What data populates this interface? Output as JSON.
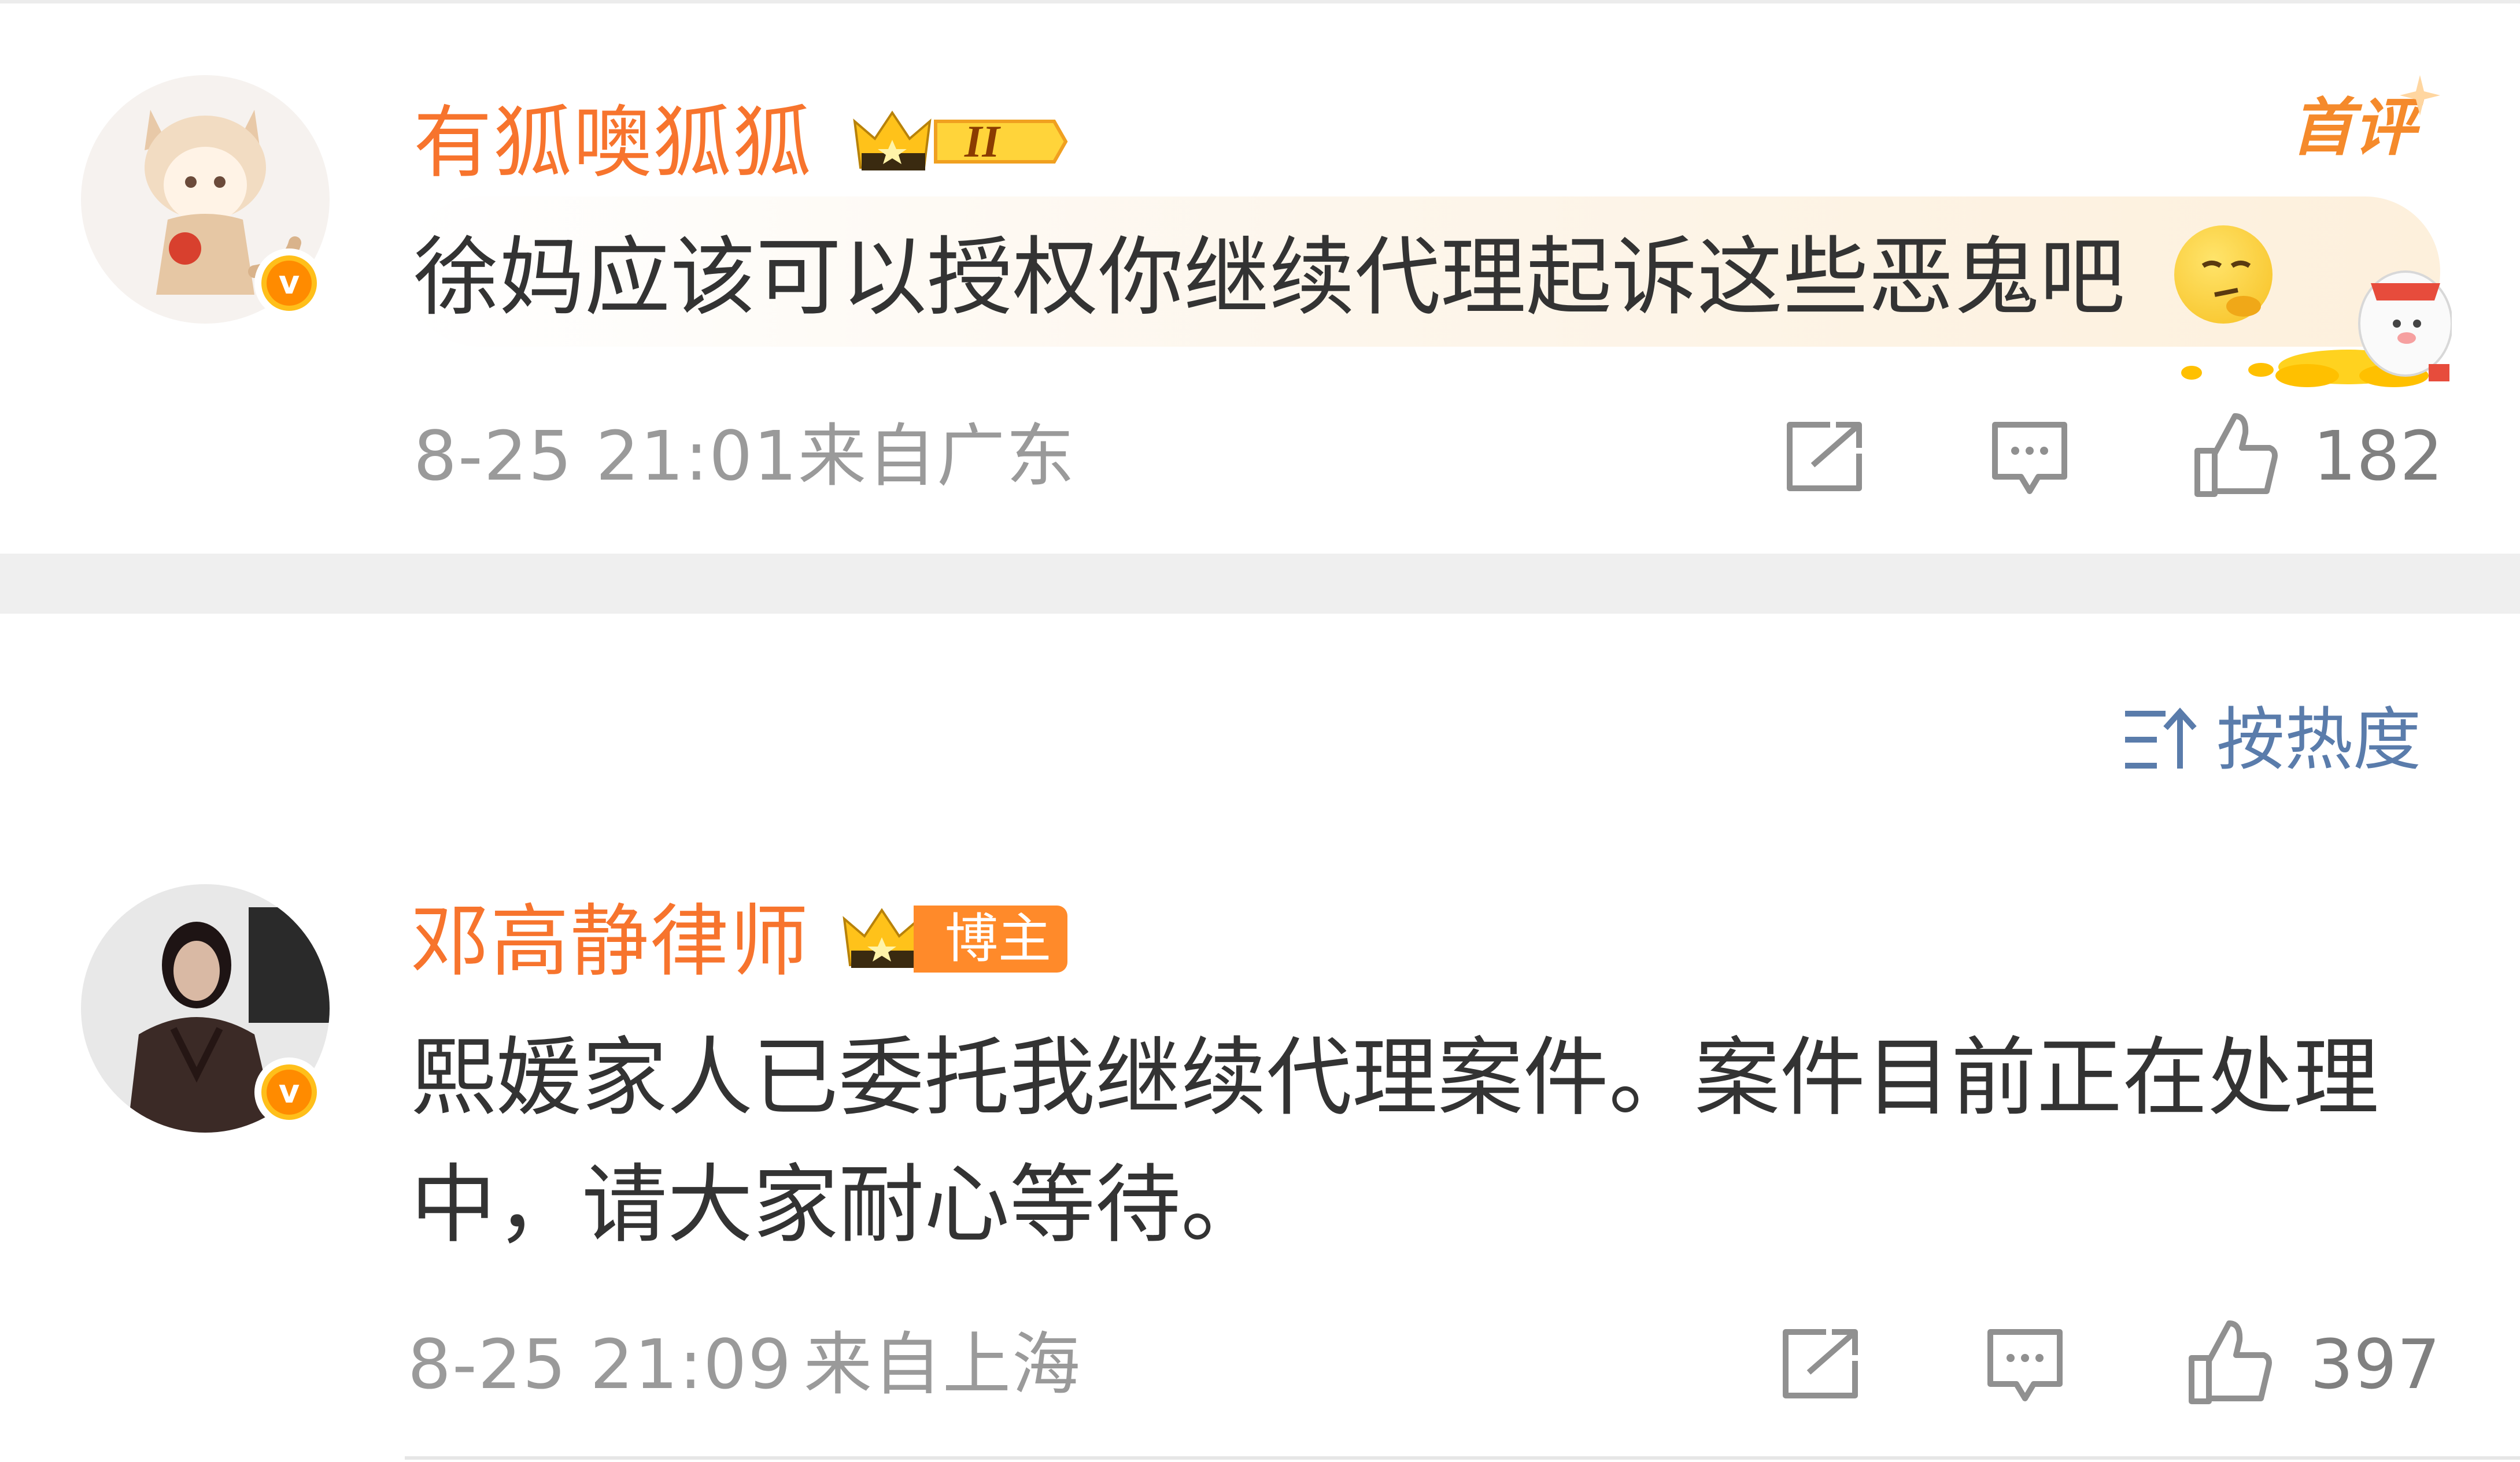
{
  "comments": [
    {
      "username": "有狐噢狐狐",
      "level_badge": "II",
      "first_comment_badge": "首评",
      "text": "徐妈应该可以授权你继续代理起诉这些恶鬼吧",
      "emoji_icon": "thinking-face-icon",
      "time": "8-25 21:01",
      "location": "来自广东",
      "like_count": "182",
      "verified_icon": "verified-v-icon",
      "colors": {
        "username": "#f7742d",
        "badge": "#ff8b00"
      }
    },
    {
      "username": "邓高静律师",
      "role_badge": "博主",
      "text_line1": "熙媛家人已委托我继续代理案件。案件目前正在处理",
      "text_line2": "中，请大家耐心等待。",
      "time": "8-25 21:09",
      "location": "来自上海",
      "like_count": "397",
      "verified_icon": "verified-v-icon"
    }
  ],
  "sort": {
    "label": "按热度",
    "icon": "sort-icon"
  },
  "actions": [
    "share-icon",
    "comment-icon",
    "like-icon"
  ]
}
